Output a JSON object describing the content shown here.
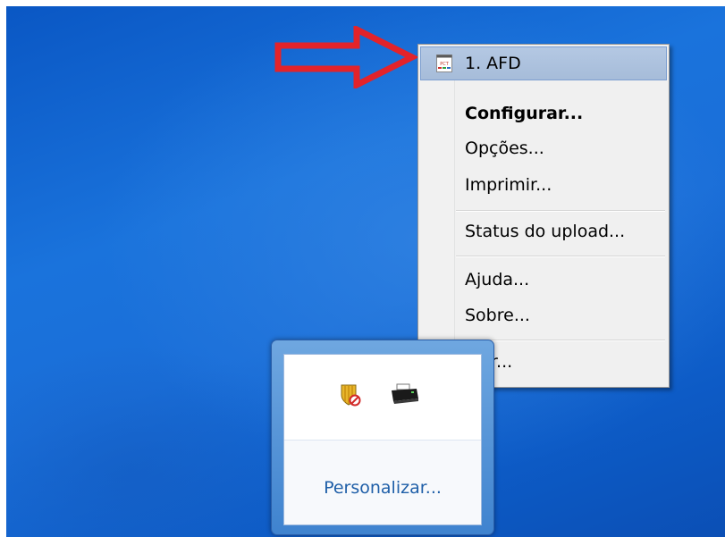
{
  "context_menu": {
    "items": [
      {
        "label": "1. AFD",
        "icon": "app-icon",
        "highlighted": true
      },
      {
        "label": "Configurar...",
        "bold": true
      },
      {
        "label": "Opções..."
      },
      {
        "label": "Imprimir..."
      },
      {
        "label": "Status do upload..."
      },
      {
        "label": "Ajuda..."
      },
      {
        "label": "Sobre..."
      },
      {
        "label": "Sair..."
      }
    ]
  },
  "tray_popup": {
    "icons": [
      "shield-icon",
      "printer-icon"
    ],
    "customize_link": "Personalizar..."
  },
  "colors": {
    "arrow": "#e3232a",
    "menu_highlight": "#a9bfdc",
    "link": "#1f5fa8",
    "desktop": "#1a6ed8"
  }
}
